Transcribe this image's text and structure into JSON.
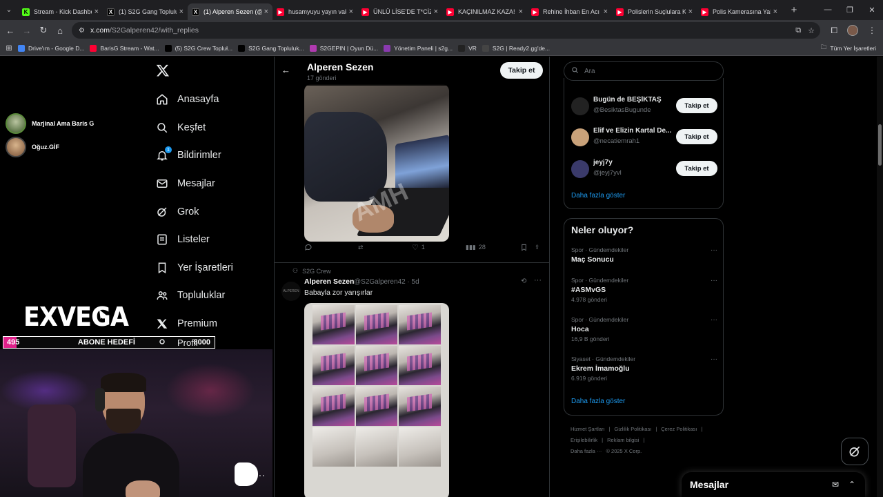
{
  "browser": {
    "tabs": [
      {
        "title": "Stream - Kick Dashbo",
        "favicon": "kick-icon",
        "active": false
      },
      {
        "title": "(1) S2G Gang Toplulu",
        "favicon": "x-icon",
        "active": false
      },
      {
        "title": "(1) Alperen Sezen (@",
        "favicon": "x-icon",
        "active": true
      },
      {
        "title": "husamyuyu yayın vak",
        "favicon": "youtube-icon",
        "active": false
      },
      {
        "title": "ÜNLÜ LİSE'DE T*CİZ",
        "favicon": "youtube-icon",
        "active": false
      },
      {
        "title": "KAÇINILMAZ KAZA!",
        "favicon": "youtube-icon",
        "active": false
      },
      {
        "title": "Rehine İhban En Acı",
        "favicon": "youtube-icon",
        "active": false
      },
      {
        "title": "Polislerin Suçlulara K",
        "favicon": "youtube-icon",
        "active": false
      },
      {
        "title": "Polis Kamerasına Yak",
        "favicon": "youtube-icon",
        "active": false
      }
    ],
    "url_host": "x.com",
    "url_path": "/S2Galperen42/with_replies",
    "bookmarks": [
      {
        "label": "Drive'ım - Google D...",
        "icon": "drive-icon",
        "color": "#4285f4"
      },
      {
        "label": "BarisG Stream - Wat...",
        "icon": "youtube-icon",
        "color": "#ff0033"
      },
      {
        "label": "(5) S2G Crew Topluł...",
        "icon": "x-icon",
        "color": "#000000"
      },
      {
        "label": "S2G Gang Topluluk...",
        "icon": "x-icon",
        "color": "#000000"
      },
      {
        "label": "S2GEPIN | Oyun Dü...",
        "icon": "s2g-icon",
        "color": "#b03ab0"
      },
      {
        "label": "Yönetim Paneli | s2g...",
        "icon": "s2g-icon",
        "color": "#8a3ab0"
      },
      {
        "label": "VR",
        "icon": "vr-icon",
        "color": "#222222"
      },
      {
        "label": "S2G | Ready2.gg'de...",
        "icon": "globe-icon",
        "color": "#444444"
      }
    ],
    "all_bookmarks": "Tüm Yer İşaretleri"
  },
  "overlay": {
    "users": [
      {
        "name": "Marjinal Ama Baris G"
      },
      {
        "name": "Oğuz.GİF"
      }
    ],
    "brand": "EXVEGA",
    "goal": {
      "current": "495",
      "label": "ABONE HEDEFİ",
      "target": "8000",
      "progress": 0.062
    }
  },
  "nav": {
    "items": [
      {
        "label": "Anasayfa",
        "icon": "home-icon"
      },
      {
        "label": "Keşfet",
        "icon": "search-icon"
      },
      {
        "label": "Bildirimler",
        "icon": "bell-icon",
        "badge": "1"
      },
      {
        "label": "Mesajlar",
        "icon": "mail-icon"
      },
      {
        "label": "Grok",
        "icon": "grok-icon"
      },
      {
        "label": "Listeler",
        "icon": "list-icon"
      },
      {
        "label": "Yer İşaretleri",
        "icon": "bookmark-icon"
      },
      {
        "label": "Topluluklar",
        "icon": "communities-icon"
      },
      {
        "label": "Premium",
        "icon": "x-icon"
      },
      {
        "label": "Profil",
        "icon": "profile-icon"
      }
    ]
  },
  "profile": {
    "name": "Alperen Sezen",
    "post_count": "17 gönderi",
    "follow_label": "Takip et"
  },
  "tweet1": {
    "watermark": "AMH",
    "stats": {
      "replies": "",
      "reposts": "",
      "likes": "1",
      "views": "28"
    }
  },
  "tweet2": {
    "community": "S2G Crew",
    "avatar_text": "ALPEREN",
    "name": "Alperen Sezen",
    "handle_time": "@S2Galperen42 · 5d",
    "text": "Babayla zor yarışırlar"
  },
  "sidebar": {
    "search_placeholder": "Ara",
    "who_to_follow": [
      {
        "name": "Bugün de BEŞİKTAŞ",
        "handle": "@BesiktasBugunde",
        "button": "Takip et",
        "avatar_color": "#222222"
      },
      {
        "name": "Elif ve Elizin Kartal De...",
        "handle": "@necatiemrah1",
        "button": "Takip et",
        "avatar_color": "#c9a27a"
      },
      {
        "name": "jeyj7y",
        "handle": "@jeyj7yvl",
        "button": "Takip et",
        "avatar_color": "#3a3a6a"
      }
    ],
    "show_more": "Daha fazla göster",
    "trends_title": "Neler oluyor?",
    "trends": [
      {
        "category": "Spor · Gündemdekiler",
        "name": "Maç Sonucu",
        "count": ""
      },
      {
        "category": "Spor · Gündemdekiler",
        "name": "#ASMvGS",
        "count": "4.978 gönderi"
      },
      {
        "category": "Spor · Gündemdekiler",
        "name": "Hoca",
        "count": "16,9 B gönderi"
      },
      {
        "category": "Siyaset · Gündemdekiler",
        "name": "Ekrem İmamoğlu",
        "count": "6.919 gönderi"
      }
    ],
    "trends_more": "Daha fazla göster",
    "footer": [
      "Hizmet Şartları",
      "|",
      "Gizlilik Politikası",
      "|",
      "Çerez Politikası",
      "|",
      "Erişilebilirlik",
      "|",
      "Reklam bilgisi",
      "|",
      "Daha fazla ···",
      "© 2025 X Corp."
    ]
  },
  "messages_drawer": {
    "title": "Mesajlar"
  }
}
